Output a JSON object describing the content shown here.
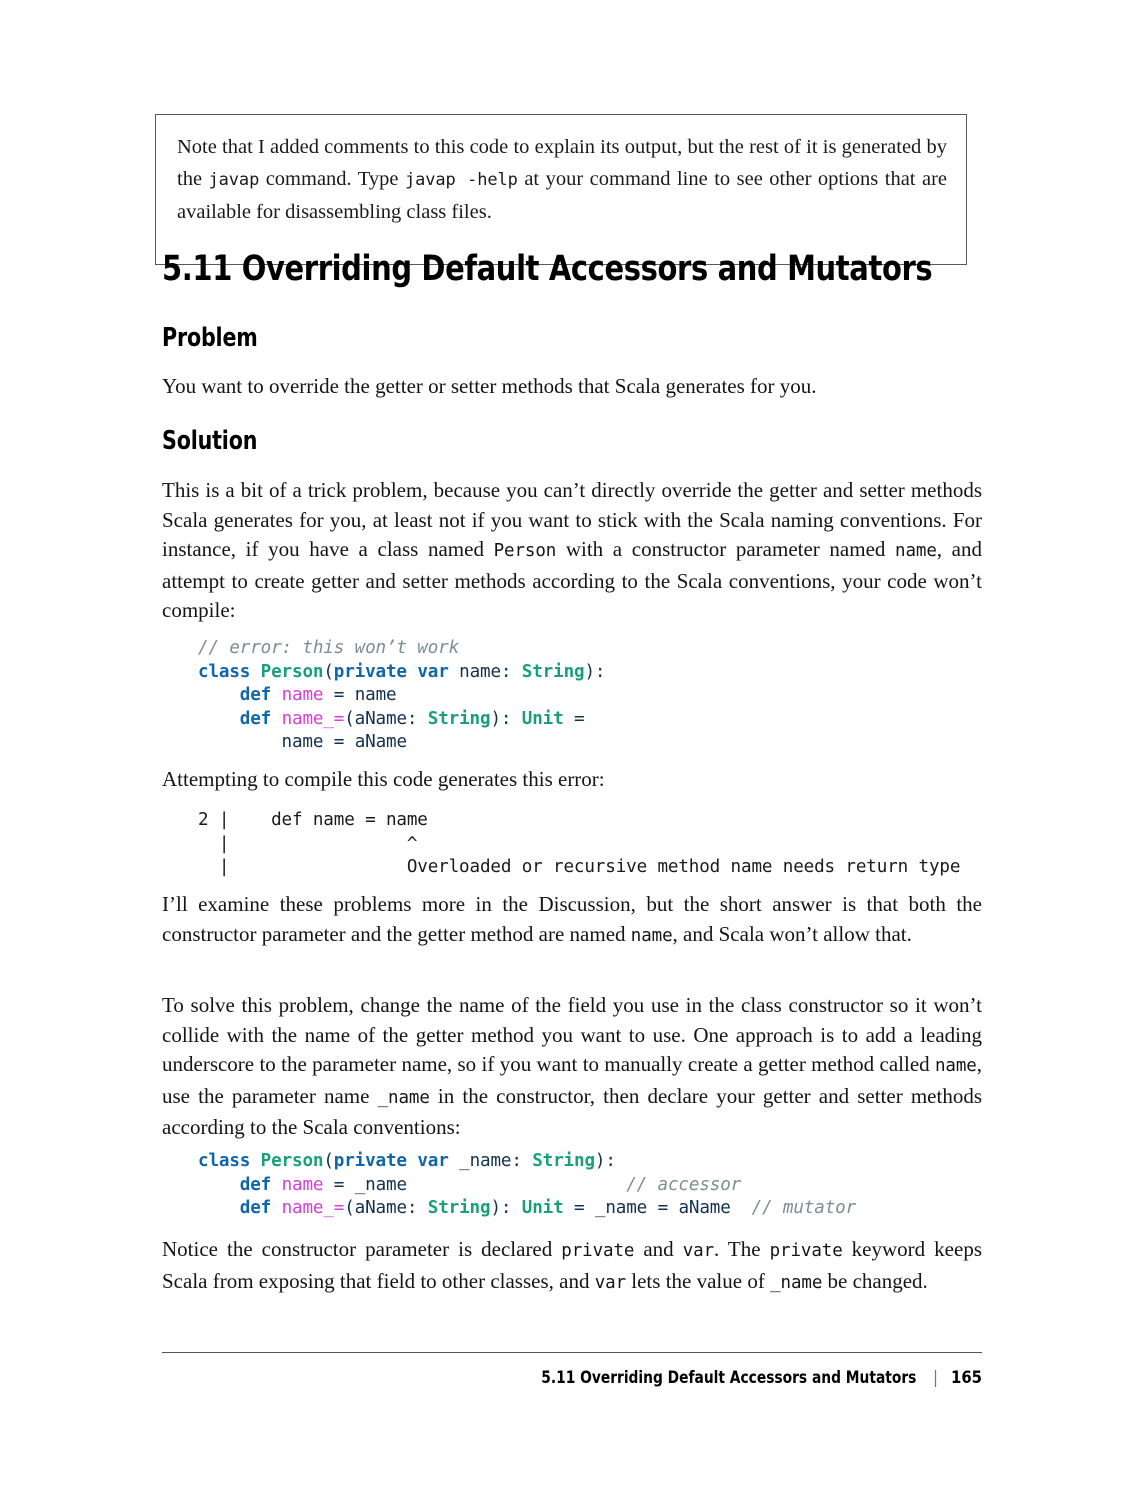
{
  "note": {
    "text_part1": "Note that I added comments to this code to explain its output, but the rest of it is generated by the ",
    "code1": "javap",
    "text_part2": " command. Type ",
    "code2": "javap -help",
    "text_part3": " at your command line to see other options that are available for disassembling class files."
  },
  "section": {
    "title": "5.11 Overriding Default Accessors and Mutators",
    "problem_heading": "Problem",
    "problem_text": "You want to override the getter or setter methods that Scala generates for you.",
    "solution_heading": "Solution"
  },
  "paragraphs": {
    "p1_a": "This is a bit of a trick problem, because you can’t directly override the getter and setter methods Scala generates for you, at least not if you want to stick with the Scala naming conventions. For instance, if you have a class named ",
    "p1_code1": "Person",
    "p1_b": " with a constructor parameter named ",
    "p1_code2": "name",
    "p1_c": ", and attempt to create getter and setter methods according to the Scala conventions, your code won’t compile:",
    "p2": "Attempting to compile this code generates this error:",
    "p3_a": "I’ll examine these problems more in the Discussion, but the short answer is that both the constructor parameter and the getter method are named ",
    "p3_code1": "name",
    "p3_b": ", and Scala won’t allow that.",
    "p4_a": "To solve this problem, change the name of the field you use in the class constructor so it won’t collide with the name of the getter method you want to use. One approach is to add a leading underscore to the parameter name, so if you want to manually create a getter method called ",
    "p4_code1": "name",
    "p4_b": ", use the parameter name ",
    "p4_code2": "_name",
    "p4_c": " in the constructor, then declare your getter and setter methods according to the Scala conventions:",
    "p5_a": "Notice the constructor parameter is declared ",
    "p5_code1": "private",
    "p5_b": " and ",
    "p5_code2": "var",
    "p5_c": ". The ",
    "p5_code3": "private",
    "p5_d": " keyword keeps Scala from exposing that field to other classes, and ",
    "p5_code4": "var",
    "p5_e": " lets the value of ",
    "p5_code5": "_name",
    "p5_f": " be changed."
  },
  "code_block_1": {
    "line1_comment": "// error: this won’t work",
    "line2": "class Person(private var name: String):",
    "line3": "    def name = name",
    "line4": "    def name_=(aName: String): Unit =",
    "line5": "        name = aName",
    "tokens": {
      "kw_class": "class",
      "type_person": "Person",
      "kw_private": "private",
      "kw_var": "var",
      "ident_name": "name",
      "type_string": "String",
      "kw_def": "def",
      "type_unit": "Unit",
      "ident_aname": "aName",
      "mth_name_eq": "name_="
    }
  },
  "error_block": {
    "line1": "2 |    def name = name",
    "line2": "  |                 ^",
    "line3": "  |                 Overloaded or recursive method name needs return type"
  },
  "code_block_2": {
    "line1": "class Person(private var _name: String):",
    "line2": "    def name = _name",
    "line3": "    def name_=(aName: String): Unit = _name = aName",
    "comment_accessor": "// accessor",
    "comment_mutator": "// mutator",
    "tokens": {
      "kw_class": "class",
      "type_person": "Person",
      "kw_private": "private",
      "kw_var": "var",
      "ident_uname": "_name",
      "type_string": "String",
      "kw_def": "def",
      "mth_name": "name",
      "mth_name_eq": "name_=",
      "ident_aname": "aName",
      "type_unit": "Unit"
    }
  },
  "footer": {
    "title": "5.11 Overriding Default Accessors and Mutators",
    "separator": "|",
    "page_number": "165"
  },
  "colors": {
    "keyword": "#1166aa",
    "type": "#18a07a",
    "method": "#d63fd6",
    "comment": "#7d8d96",
    "plain_code": "#12304f",
    "text": "#141414",
    "border": "#5a5a5a"
  }
}
